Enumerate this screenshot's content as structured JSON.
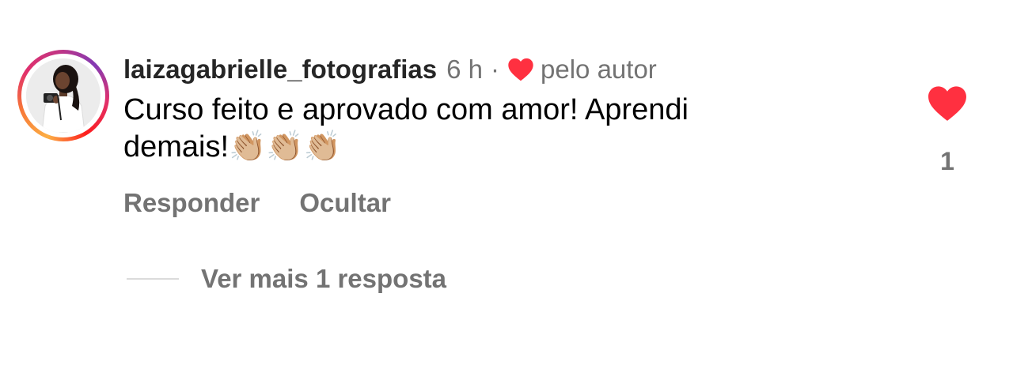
{
  "comment": {
    "username": "laizagabrielle_fotografias",
    "time": "6 h",
    "separator": "·",
    "author_like_label": "pelo autor",
    "text": "Curso feito e aprovado com amor! Aprendi demais!",
    "emoji": "👏🏼👏🏼👏🏼",
    "avatar_icon": "profile-photo-woman-with-camera"
  },
  "actions": {
    "reply_label": "Responder",
    "hide_label": "Ocultar"
  },
  "like": {
    "icon": "heart-filled-icon",
    "count": "1",
    "color": "#ff3040"
  },
  "replies": {
    "view_more_label": "Ver mais 1 resposta"
  },
  "colors": {
    "secondary_text": "#737373",
    "username_text": "#262626",
    "heart_red": "#ff3040"
  }
}
